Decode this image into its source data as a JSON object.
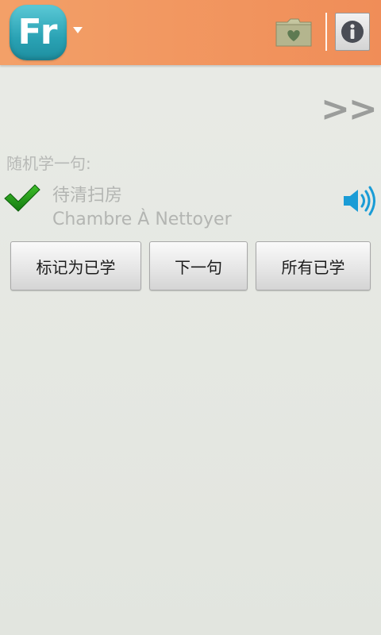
{
  "header": {
    "logo_text": "Fr",
    "logo_color": "#2aa2b4",
    "header_color": "#f08d58",
    "icons": [
      "caret-down-icon",
      "favorites-folder-icon",
      "info-icon"
    ]
  },
  "nav": {
    "next_label": ">>"
  },
  "random_sentence": {
    "section_label": "随机学一句:",
    "chinese": "待清扫房",
    "french": "Chambre À Nettoyer",
    "status_icon": "checkmark-icon",
    "audio_icon": "speaker-icon",
    "audio_color": "#1a9cd6"
  },
  "actions": {
    "mark_learned": "标记为已学",
    "next_sentence": "下一句",
    "all_learned": "所有已学"
  }
}
